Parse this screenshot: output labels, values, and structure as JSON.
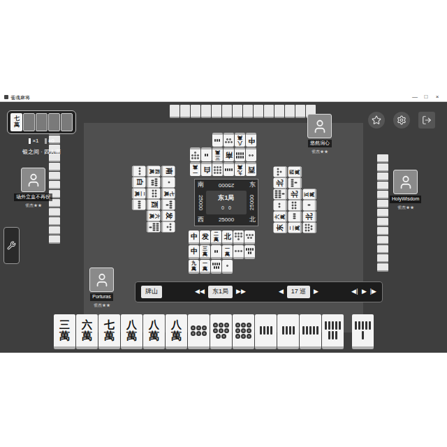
{
  "window": {
    "title": "雀魂麻将",
    "controls": [
      "—",
      "□",
      "×"
    ]
  },
  "dora_panel": {
    "indicators": [
      {
        "kind": "man",
        "text": "七萬"
      },
      {
        "kind": "back"
      },
      {
        "kind": "back"
      },
      {
        "kind": "back"
      },
      {
        "kind": "back"
      }
    ],
    "riichi_sticks": "×1",
    "honba": "×0",
    "room": "银之间 · 四人南"
  },
  "round": {
    "label": "东1局",
    "counters": [
      "0",
      "0"
    ]
  },
  "players": [
    {
      "seat": "bottom",
      "name": "Porturas",
      "rank": "雀杰★★",
      "score": "25000",
      "wind": "西",
      "hand_count": 13,
      "discards": [
        {
          "kind": "honor",
          "text": "中"
        },
        {
          "kind": "honor",
          "text": "发"
        },
        {
          "kind": "man",
          "text": "二萬"
        },
        {
          "kind": "honor",
          "text": "北"
        },
        {
          "kind": "pin",
          "value": 7
        },
        {
          "kind": "pin",
          "value": 5
        },
        {
          "kind": "honor",
          "text": "中"
        },
        {
          "kind": "man",
          "text": "三萬"
        },
        {
          "kind": "sou",
          "value": 2
        },
        {
          "kind": "man",
          "text": "一萬"
        },
        {
          "kind": "pin",
          "value": 3
        },
        {
          "kind": "sou",
          "value": 6
        },
        {
          "kind": "man",
          "text": "九萬"
        },
        {
          "kind": "man",
          "text": "一萬"
        },
        {
          "kind": "sou",
          "value": 7
        },
        {
          "kind": "pin",
          "value": 1
        }
      ]
    },
    {
      "seat": "right",
      "name": "HolyWisdom",
      "rank": "雀杰★★",
      "score": "25000",
      "wind": "北",
      "hand_count": 13,
      "discards": [
        {
          "kind": "honor",
          "text": "东"
        },
        {
          "kind": "man",
          "text": "六萬"
        },
        {
          "kind": "pin",
          "value": 2
        },
        {
          "kind": "sou",
          "value": 9
        },
        {
          "kind": "honor",
          "text": "北"
        },
        {
          "kind": "pin",
          "value": 4
        },
        {
          "kind": "man",
          "text": "二萬"
        },
        {
          "kind": "sou",
          "value": 3
        },
        {
          "kind": "pin",
          "value": 6
        },
        {
          "kind": "honor",
          "text": "北"
        },
        {
          "kind": "sou",
          "value": 5
        },
        {
          "kind": "man",
          "text": "四萬"
        },
        {
          "kind": "pin",
          "value": 8
        },
        {
          "kind": "honor",
          "text": "北"
        },
        {
          "kind": "sou",
          "value": 1
        },
        {
          "kind": "man",
          "text": "五萬"
        }
      ]
    },
    {
      "seat": "top",
      "name": "悠然润心",
      "rank": "雀杰★★",
      "score": "25000",
      "wind": "东",
      "hand_count": 14,
      "discards": [
        {
          "kind": "honor",
          "text": "西"
        },
        {
          "kind": "man",
          "text": "九萬"
        },
        {
          "kind": "sou",
          "value": 4
        },
        {
          "kind": "pin",
          "value": 9
        },
        {
          "kind": "honor",
          "text": "白"
        },
        {
          "kind": "man",
          "text": "一萬"
        },
        {
          "kind": "pin",
          "value": 2
        },
        {
          "kind": "sou",
          "value": 8
        },
        {
          "kind": "honor",
          "text": "南"
        },
        {
          "kind": "man",
          "text": "三萬"
        },
        {
          "kind": "sou",
          "value": 2
        },
        {
          "kind": "pin",
          "value": 7
        },
        {
          "kind": "honor",
          "text": "中"
        },
        {
          "kind": "man",
          "text": "八萬"
        },
        {
          "kind": "pin",
          "value": 5
        },
        {
          "kind": "sou",
          "value": 3
        }
      ]
    },
    {
      "seat": "left",
      "name": "场外立直不再役",
      "rank": "雀杰★★",
      "score": "25000",
      "wind": "南",
      "hand_count": 13,
      "discards": [
        {
          "kind": "honor",
          "text": "南"
        },
        {
          "kind": "pin",
          "value": 1
        },
        {
          "kind": "man",
          "text": "七萬"
        },
        {
          "kind": "sou",
          "value": 5
        },
        {
          "kind": "honor",
          "text": "发"
        },
        {
          "kind": "pin",
          "value": 4
        },
        {
          "kind": "man",
          "text": "四萬"
        },
        {
          "kind": "sou",
          "value": 7
        },
        {
          "kind": "pin",
          "value": 6
        },
        {
          "kind": "honor",
          "text": "西"
        },
        {
          "kind": "man",
          "text": "六萬"
        },
        {
          "kind": "sou",
          "value": 9
        },
        {
          "kind": "pin",
          "value": 3
        },
        {
          "kind": "honor",
          "text": "白"
        },
        {
          "kind": "man",
          "text": "二萬"
        },
        {
          "kind": "sou",
          "value": 4
        }
      ]
    }
  ],
  "replay_bar": {
    "wall_button": "牌山",
    "round_group": [
      "◀◀",
      "东1局",
      "▶▶"
    ],
    "turn_group": [
      "◀",
      "17 巡",
      "▶"
    ],
    "step_group": [
      "◀|",
      "▶",
      "|▶"
    ]
  },
  "hand": {
    "tiles": [
      {
        "kind": "man",
        "text": "三萬"
      },
      {
        "kind": "man",
        "text": "六萬"
      },
      {
        "kind": "man",
        "text": "七萬"
      },
      {
        "kind": "man",
        "text": "八萬"
      },
      {
        "kind": "man",
        "text": "八萬"
      },
      {
        "kind": "man",
        "text": "八萬"
      },
      {
        "kind": "pin",
        "value": 6
      },
      {
        "kind": "pin",
        "value": 8
      },
      {
        "kind": "pin",
        "value": 9
      },
      {
        "kind": "sou",
        "value": 4
      },
      {
        "kind": "sou",
        "value": 4
      },
      {
        "kind": "sou",
        "value": 5
      },
      {
        "kind": "sou",
        "value": 8
      }
    ],
    "drawn": {
      "kind": "sou",
      "value": 6
    }
  }
}
